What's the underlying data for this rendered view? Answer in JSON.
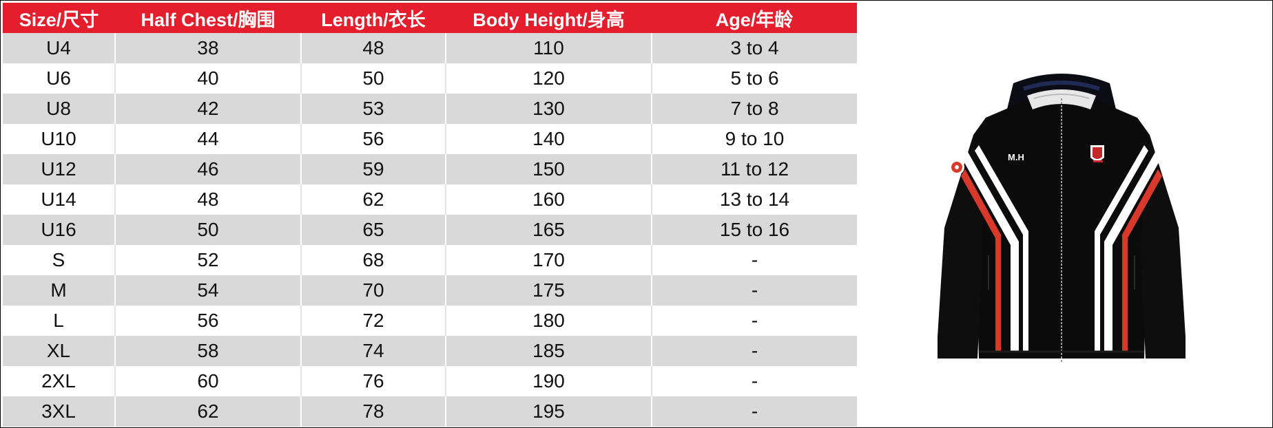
{
  "colors": {
    "header_bg": "#e41e2d",
    "header_text": "#ffffff",
    "row_shade": "#d9d9d9",
    "row_plain": "#ffffff"
  },
  "table": {
    "headers": [
      "Size/尺寸",
      "Half Chest/胸围",
      "Length/衣长",
      "Body Height/身高",
      "Age/年龄"
    ],
    "rows": [
      [
        "U4",
        "38",
        "48",
        "110",
        "3 to 4"
      ],
      [
        "U6",
        "40",
        "50",
        "120",
        "5 to 6"
      ],
      [
        "U8",
        "42",
        "53",
        "130",
        "7 to 8"
      ],
      [
        "U10",
        "44",
        "56",
        "140",
        "9 to 10"
      ],
      [
        "U12",
        "46",
        "59",
        "150",
        "11 to 12"
      ],
      [
        "U14",
        "48",
        "62",
        "160",
        "13 to 14"
      ],
      [
        "U16",
        "50",
        "65",
        "165",
        "15 to 16"
      ],
      [
        "S",
        "52",
        "68",
        "170",
        "-"
      ],
      [
        "M",
        "54",
        "70",
        "175",
        "-"
      ],
      [
        "L",
        "56",
        "72",
        "180",
        "-"
      ],
      [
        "XL",
        "58",
        "74",
        "185",
        "-"
      ],
      [
        "2XL",
        "60",
        "76",
        "190",
        "-"
      ],
      [
        "3XL",
        "62",
        "78",
        "195",
        "-"
      ]
    ]
  },
  "jacket": {
    "chest_print": "M.H"
  }
}
